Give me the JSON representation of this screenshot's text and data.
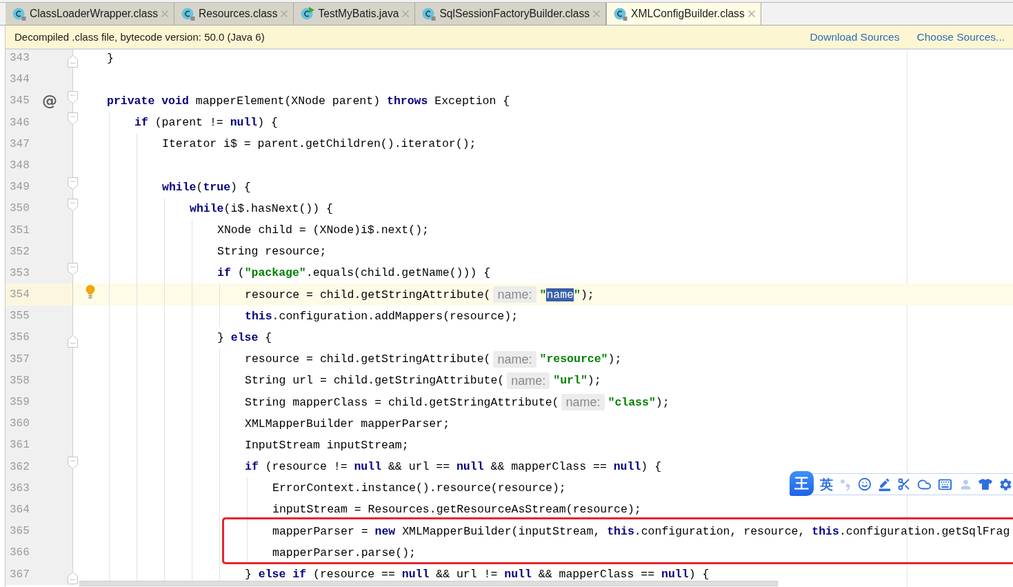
{
  "tabs": [
    {
      "label": "ClassLoaderWrapper.class",
      "kind": "class",
      "selected": false
    },
    {
      "label": "Resources.class",
      "kind": "class",
      "selected": false
    },
    {
      "label": "TestMyBatis.java",
      "kind": "runnable",
      "selected": false
    },
    {
      "label": "SqlSessionFactoryBuilder.class",
      "kind": "class",
      "selected": false
    },
    {
      "label": "XMLConfigBuilder.class",
      "kind": "class",
      "selected": true
    }
  ],
  "banner": {
    "message": "Decompiled .class file, bytecode version: 50.0 (Java 6)",
    "links": [
      "Download Sources",
      "Choose Sources..."
    ]
  },
  "editor": {
    "lines": [
      {
        "number": "343",
        "fold_start": false,
        "fold_end": true,
        "current": false,
        "tokens": [
          {
            "kind": "plain",
            "text": "}"
          }
        ]
      },
      {
        "number": "344",
        "fold_start": false,
        "fold_end": false,
        "current": false
      },
      {
        "number": "345",
        "fold_start": true,
        "fold_end": false,
        "gutter_mark": "@",
        "current": false,
        "tokens": [
          {
            "kind": "keyword",
            "text": "private void"
          },
          {
            "kind": "plain",
            "text": " mapperElement(XNode parent) "
          },
          {
            "kind": "keyword",
            "text": "throws"
          },
          {
            "kind": "plain",
            "text": " Exception {"
          }
        ],
        "children": [
          {
            "number": "346",
            "fold_start": true,
            "fold_end": false,
            "current": false,
            "tokens": [
              {
                "kind": "keyword",
                "text": "if"
              },
              {
                "kind": "plain",
                "text": " (parent != "
              },
              {
                "kind": "keyword",
                "text": "null"
              },
              {
                "kind": "plain",
                "text": ") {"
              }
            ],
            "children": [
              {
                "number": "347",
                "fold_start": false,
                "fold_end": false,
                "current": false,
                "tokens": [
                  {
                    "kind": "plain",
                    "text": "Iterator i$ = parent.getChildren().iterator();"
                  }
                ]
              },
              {
                "number": "348",
                "fold_start": false,
                "fold_end": false,
                "current": false
              },
              {
                "number": "349",
                "fold_start": true,
                "fold_end": false,
                "current": false,
                "tokens": [
                  {
                    "kind": "keyword",
                    "text": "while"
                  },
                  {
                    "kind": "plain",
                    "text": "("
                  },
                  {
                    "kind": "keyword",
                    "text": "true"
                  },
                  {
                    "kind": "plain",
                    "text": ") {"
                  }
                ],
                "children": [
                  {
                    "number": "350",
                    "fold_start": true,
                    "fold_end": false,
                    "current": false,
                    "tokens": [
                      {
                        "kind": "keyword",
                        "text": "while"
                      },
                      {
                        "kind": "plain",
                        "text": "(i$.hasNext()) {"
                      }
                    ],
                    "children": [
                      {
                        "number": "351",
                        "fold_start": false,
                        "fold_end": false,
                        "current": false,
                        "tokens": [
                          {
                            "kind": "plain",
                            "text": "XNode child = (XNode)i$.next();"
                          }
                        ]
                      },
                      {
                        "number": "352",
                        "fold_start": false,
                        "fold_end": false,
                        "current": false,
                        "tokens": [
                          {
                            "kind": "plain",
                            "text": "String resource;"
                          }
                        ]
                      },
                      {
                        "number": "353",
                        "fold_start": true,
                        "fold_end": false,
                        "current": false,
                        "tokens": [
                          {
                            "kind": "keyword",
                            "text": "if"
                          },
                          {
                            "kind": "plain",
                            "text": " ("
                          },
                          {
                            "kind": "string",
                            "text": "\"package\""
                          },
                          {
                            "kind": "plain",
                            "text": ".equals(child.getName())) {"
                          }
                        ],
                        "children": [
                          {
                            "number": "354",
                            "fold_start": false,
                            "fold_end": false,
                            "current": true,
                            "tokens": [
                              {
                                "kind": "plain",
                                "text": "resource = child.getStringAttribute("
                              },
                              {
                                "kind": "hint",
                                "text": "name:"
                              },
                              {
                                "kind": "string",
                                "text": "\""
                              },
                              {
                                "kind": "selection",
                                "text": "name"
                              },
                              {
                                "kind": "string",
                                "text": "\""
                              },
                              {
                                "kind": "plain",
                                "text": ");"
                              }
                            ]
                          },
                          {
                            "number": "355",
                            "fold_start": false,
                            "fold_end": false,
                            "current": false,
                            "tokens": [
                              {
                                "kind": "keyword",
                                "text": "this"
                              },
                              {
                                "kind": "plain",
                                "text": ".configuration.addMappers(resource);"
                              }
                            ]
                          }
                        ]
                      },
                      {
                        "number": "356",
                        "fold_start": false,
                        "fold_end": true,
                        "current": false,
                        "tokens": [
                          {
                            "kind": "plain",
                            "text": "} "
                          },
                          {
                            "kind": "keyword",
                            "text": "else"
                          },
                          {
                            "kind": "plain",
                            "text": " {"
                          }
                        ],
                        "children": [
                          {
                            "number": "357",
                            "fold_start": false,
                            "fold_end": false,
                            "current": false,
                            "tokens": [
                              {
                                "kind": "plain",
                                "text": "resource = child.getStringAttribute("
                              },
                              {
                                "kind": "hint",
                                "text": "name:"
                              },
                              {
                                "kind": "string",
                                "text": "\"resource\""
                              },
                              {
                                "kind": "plain",
                                "text": ");"
                              }
                            ]
                          },
                          {
                            "number": "358",
                            "fold_start": false,
                            "fold_end": false,
                            "current": false,
                            "tokens": [
                              {
                                "kind": "plain",
                                "text": "String url = child.getStringAttribute("
                              },
                              {
                                "kind": "hint",
                                "text": "name:"
                              },
                              {
                                "kind": "string",
                                "text": "\"url\""
                              },
                              {
                                "kind": "plain",
                                "text": ");"
                              }
                            ]
                          },
                          {
                            "number": "359",
                            "fold_start": false,
                            "fold_end": false,
                            "current": false,
                            "tokens": [
                              {
                                "kind": "plain",
                                "text": "String mapperClass = child.getStringAttribute("
                              },
                              {
                                "kind": "hint",
                                "text": "name:"
                              },
                              {
                                "kind": "string",
                                "text": "\"class\""
                              },
                              {
                                "kind": "plain",
                                "text": ");"
                              }
                            ]
                          },
                          {
                            "number": "360",
                            "fold_start": false,
                            "fold_end": false,
                            "current": false,
                            "tokens": [
                              {
                                "kind": "plain",
                                "text": "XMLMapperBuilder mapperParser;"
                              }
                            ]
                          },
                          {
                            "number": "361",
                            "fold_start": false,
                            "fold_end": false,
                            "current": false,
                            "tokens": [
                              {
                                "kind": "plain",
                                "text": "InputStream inputStream;"
                              }
                            ]
                          },
                          {
                            "number": "362",
                            "fold_start": true,
                            "fold_end": false,
                            "current": false,
                            "tokens": [
                              {
                                "kind": "keyword",
                                "text": "if"
                              },
                              {
                                "kind": "plain",
                                "text": " (resource != "
                              },
                              {
                                "kind": "keyword",
                                "text": "null"
                              },
                              {
                                "kind": "plain",
                                "text": " && url == "
                              },
                              {
                                "kind": "keyword",
                                "text": "null"
                              },
                              {
                                "kind": "plain",
                                "text": " && mapperClass == "
                              },
                              {
                                "kind": "keyword",
                                "text": "null"
                              },
                              {
                                "kind": "plain",
                                "text": ") {"
                              }
                            ],
                            "children": [
                              {
                                "number": "363",
                                "fold_start": false,
                                "fold_end": false,
                                "current": false,
                                "tokens": [
                                  {
                                    "kind": "plain",
                                    "text": "ErrorContext.instance().resource(resource);"
                                  }
                                ]
                              },
                              {
                                "number": "364",
                                "fold_start": false,
                                "fold_end": false,
                                "current": false,
                                "tokens": [
                                  {
                                    "kind": "plain",
                                    "text": "inputStream = Resources.getResourceAsStream(resource);"
                                  }
                                ]
                              },
                              {
                                "number": "365",
                                "fold_start": false,
                                "fold_end": false,
                                "current": false,
                                "tokens": [
                                  {
                                    "kind": "plain",
                                    "text": "mapperParser = "
                                  },
                                  {
                                    "kind": "keyword",
                                    "text": "new"
                                  },
                                  {
                                    "kind": "plain",
                                    "text": " XMLMapperBuilder(inputStream, "
                                  },
                                  {
                                    "kind": "keyword",
                                    "text": "this"
                                  },
                                  {
                                    "kind": "plain",
                                    "text": ".configuration, resource, "
                                  },
                                  {
                                    "kind": "keyword",
                                    "text": "this"
                                  },
                                  {
                                    "kind": "plain",
                                    "text": ".configuration.getSqlFrag"
                                  }
                                ]
                              },
                              {
                                "number": "366",
                                "fold_start": false,
                                "fold_end": false,
                                "current": false,
                                "tokens": [
                                  {
                                    "kind": "plain",
                                    "text": "mapperParser.parse();"
                                  }
                                ]
                              }
                            ]
                          },
                          {
                            "number": "367",
                            "fold_start": false,
                            "fold_end": true,
                            "current": false,
                            "tokens": [
                              {
                                "kind": "plain",
                                "text": "} "
                              },
                              {
                                "kind": "keyword",
                                "text": "else if"
                              },
                              {
                                "kind": "plain",
                                "text": " (resource == "
                              },
                              {
                                "kind": "keyword",
                                "text": "null"
                              },
                              {
                                "kind": "plain",
                                "text": " && url != "
                              },
                              {
                                "kind": "keyword",
                                "text": "null"
                              },
                              {
                                "kind": "plain",
                                "text": " && mapperClass == "
                              },
                              {
                                "kind": "keyword",
                                "text": "null"
                              },
                              {
                                "kind": "plain",
                                "text": ") {"
                              }
                            ]
                          }
                        ]
                      }
                    ]
                  }
                ]
              }
            ]
          }
        ]
      }
    ]
  },
  "ime_toolbar": {
    "logo": "王",
    "mode": "英"
  }
}
